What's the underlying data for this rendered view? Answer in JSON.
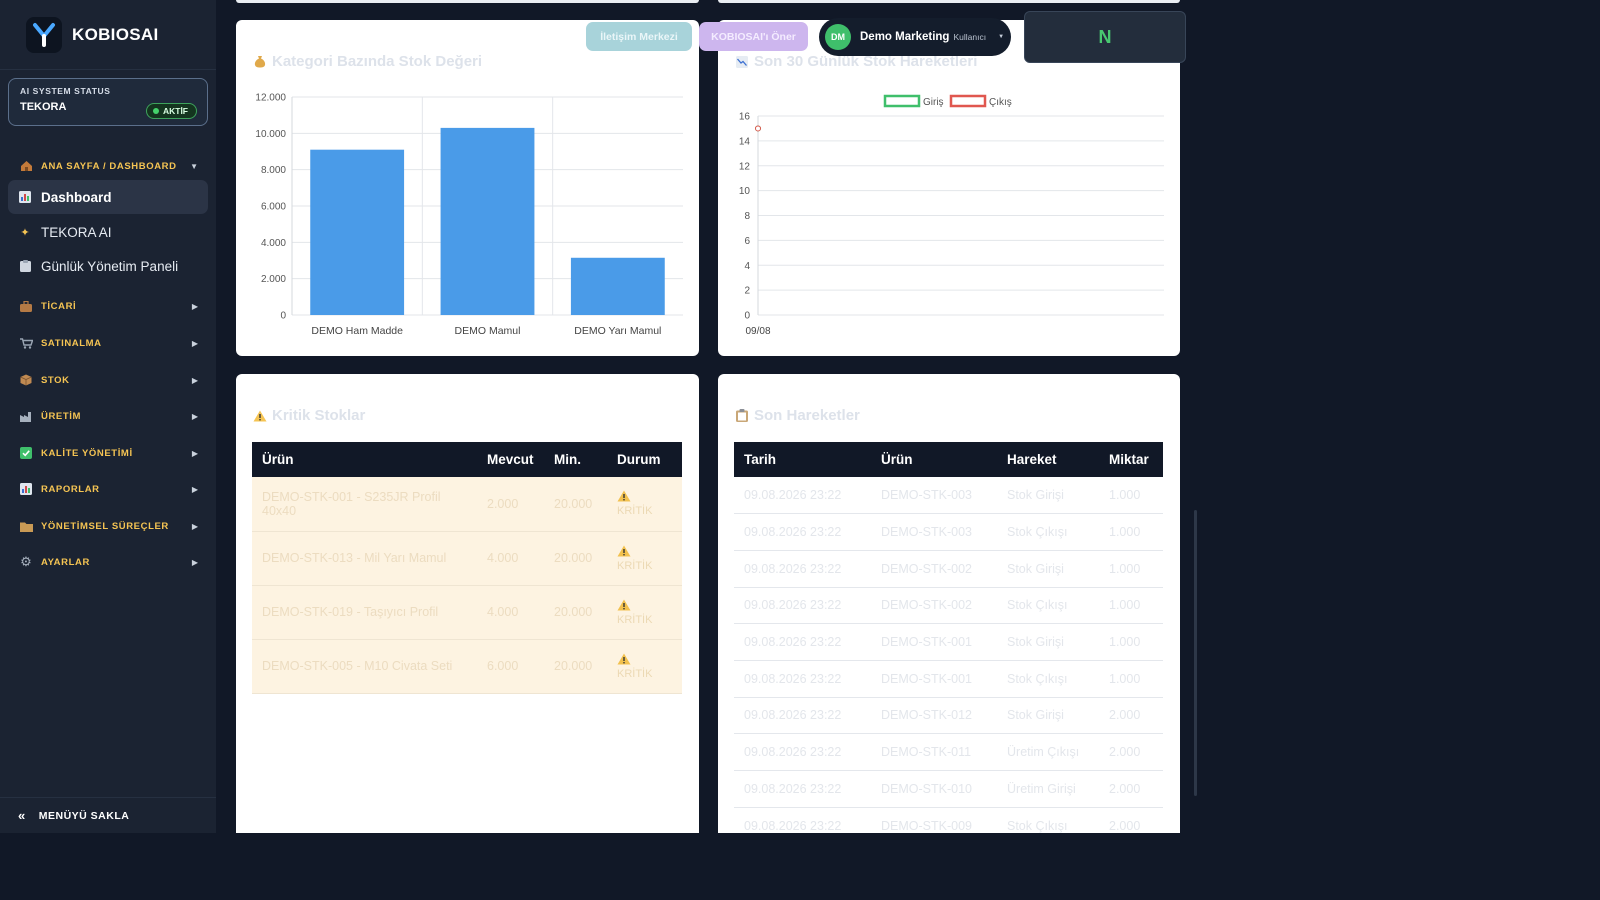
{
  "app": {
    "name": "KOBIOSAI"
  },
  "status": {
    "label": "AI SYSTEM STATUS",
    "name": "TEKORA",
    "badge": "AKTİF"
  },
  "sidebar": {
    "home_section": "ANA SAYFA / DASHBOARD",
    "home_items": [
      {
        "label": "Dashboard",
        "icon": "bar-chart-icon"
      },
      {
        "label": "TEKORA AI",
        "icon": "sparkles-icon"
      },
      {
        "label": "Günlük Yönetim Paneli",
        "icon": "clipboard-icon"
      }
    ],
    "sections": [
      {
        "label": "TİCARİ",
        "icon": "briefcase-icon"
      },
      {
        "label": "SATINALMA",
        "icon": "cart-icon"
      },
      {
        "label": "STOK",
        "icon": "box-icon"
      },
      {
        "label": "ÜRETİM",
        "icon": "factory-icon"
      },
      {
        "label": "KALİTE YÖNETİMİ",
        "icon": "check-icon"
      },
      {
        "label": "RAPORLAR",
        "icon": "report-icon"
      },
      {
        "label": "YÖNETİMSEL SÜREÇLER",
        "icon": "folder-icon"
      },
      {
        "label": "AYARLAR",
        "icon": "gear-icon"
      }
    ],
    "footer": "MENÜYÜ SAKLA"
  },
  "header": {
    "contact_button": "İletişim Merkezi",
    "suggest_button": "KOBIOSAI'ı Öner",
    "user_initials": "DM",
    "user_name": "Demo Marketing",
    "user_role": "Kullanıcı",
    "notif_letter": "N"
  },
  "colors": {
    "accent": "#4a9be8",
    "sidebar": "#1b2332",
    "giris": "#3fbf6b",
    "cikis": "#e0574f",
    "warning": "#f5c453"
  },
  "category_card": {
    "title": "Kategori Bazında Stok Değeri"
  },
  "movements_card": {
    "title": "Son 30 Günlük Stok Hareketleri"
  },
  "chart_data": [
    {
      "type": "bar",
      "title": "Kategori Bazında Stok Değeri",
      "categories": [
        "DEMO Ham Madde",
        "DEMO Mamul",
        "DEMO Yarı Mamul"
      ],
      "values": [
        9100,
        10300,
        3150
      ],
      "ylim": [
        0,
        12000
      ],
      "yticks": [
        "0",
        "2.000",
        "4.000",
        "6.000",
        "8.000",
        "10.000",
        "12.000"
      ],
      "grid": true
    },
    {
      "type": "line",
      "title": "Son 30 Günlük Stok Hareketleri",
      "categories": [
        "09/08"
      ],
      "series": [
        {
          "name": "Giriş",
          "values": [
            15
          ]
        },
        {
          "name": "Çıkış",
          "values": [
            15
          ]
        }
      ],
      "ylim": [
        0,
        16
      ],
      "yticks": [
        "0",
        "2",
        "4",
        "6",
        "8",
        "10",
        "12",
        "14",
        "16"
      ],
      "legend": "top-center",
      "grid": true
    }
  ],
  "critical": {
    "title": "Kritik Stoklar",
    "columns": [
      "Ürün",
      "Mevcut",
      "Min.",
      "Durum"
    ],
    "rows": [
      {
        "urun": "DEMO-STK-001 - S235JR Profil 40x40",
        "mevcut": "2.000",
        "min": "20.000",
        "durum": "KRİTİK"
      },
      {
        "urun": "DEMO-STK-013 - Mil Yarı Mamul",
        "mevcut": "4.000",
        "min": "20.000",
        "durum": "KRİTİK"
      },
      {
        "urun": "DEMO-STK-019 - Taşıyıcı Profil",
        "mevcut": "4.000",
        "min": "20.000",
        "durum": "KRİTİK"
      },
      {
        "urun": "DEMO-STK-005 - M10 Civata Seti",
        "mevcut": "6.000",
        "min": "20.000",
        "durum": "KRİTİK"
      }
    ]
  },
  "recent": {
    "title": "Son Hareketler",
    "columns": [
      "Tarih",
      "Ürün",
      "Hareket",
      "Miktar"
    ],
    "rows": [
      {
        "tarih": "09.08.2026 23:22",
        "urun": "DEMO-STK-003",
        "hareket": "Stok Girişi",
        "miktar": "1.000"
      },
      {
        "tarih": "09.08.2026 23:22",
        "urun": "DEMO-STK-003",
        "hareket": "Stok Çıkışı",
        "miktar": "1.000"
      },
      {
        "tarih": "09.08.2026 23:22",
        "urun": "DEMO-STK-002",
        "hareket": "Stok Girişi",
        "miktar": "1.000"
      },
      {
        "tarih": "09.08.2026 23:22",
        "urun": "DEMO-STK-002",
        "hareket": "Stok Çıkışı",
        "miktar": "1.000"
      },
      {
        "tarih": "09.08.2026 23:22",
        "urun": "DEMO-STK-001",
        "hareket": "Stok Girişi",
        "miktar": "1.000"
      },
      {
        "tarih": "09.08.2026 23:22",
        "urun": "DEMO-STK-001",
        "hareket": "Stok Çıkışı",
        "miktar": "1.000"
      },
      {
        "tarih": "09.08.2026 23:22",
        "urun": "DEMO-STK-012",
        "hareket": "Stok Girişi",
        "miktar": "2.000"
      },
      {
        "tarih": "09.08.2026 23:22",
        "urun": "DEMO-STK-011",
        "hareket": "Üretim Çıkışı",
        "miktar": "2.000"
      },
      {
        "tarih": "09.08.2026 23:22",
        "urun": "DEMO-STK-010",
        "hareket": "Üretim Girişi",
        "miktar": "2.000"
      },
      {
        "tarih": "09.08.2026 23:22",
        "urun": "DEMO-STK-009",
        "hareket": "Stok Çıkışı",
        "miktar": "2.000"
      }
    ]
  }
}
